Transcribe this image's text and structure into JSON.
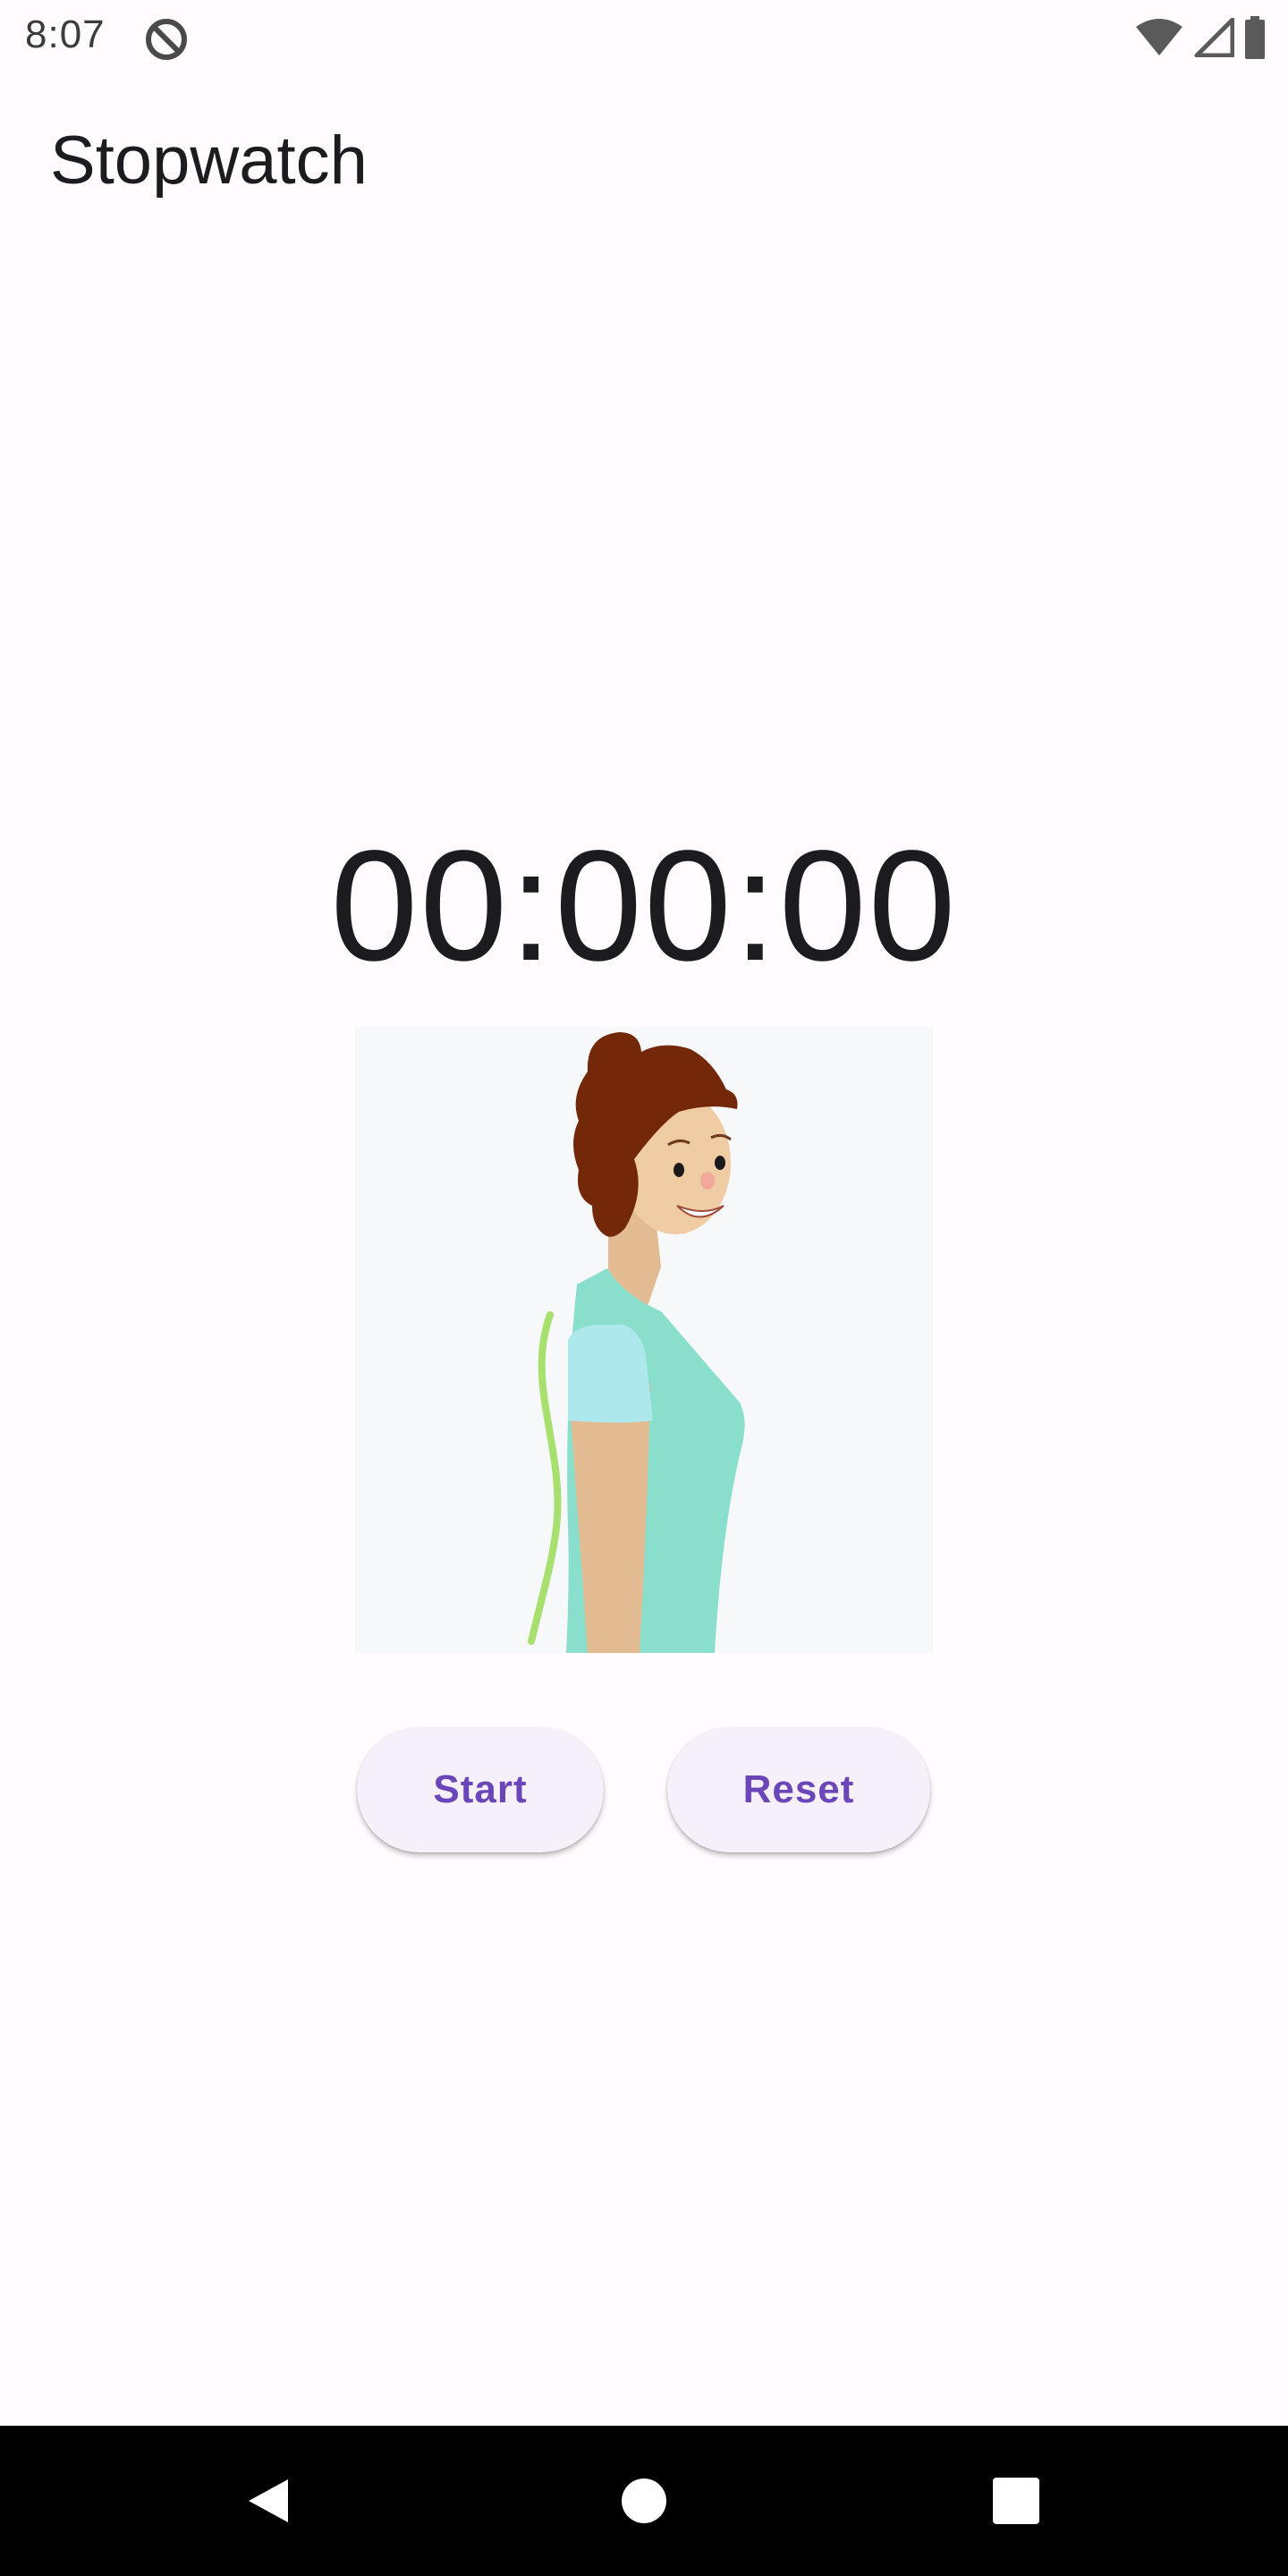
{
  "status_bar": {
    "time": "8:07",
    "icons": [
      "do-not-disturb-icon",
      "wifi-icon",
      "signal-icon",
      "battery-icon"
    ]
  },
  "app_bar": {
    "title": "Stopwatch"
  },
  "stopwatch": {
    "display": "00:00:00"
  },
  "illustration": {
    "subject": "woman-posture-illustration"
  },
  "controls": {
    "start_label": "Start",
    "reset_label": "Reset"
  },
  "nav_bar": {
    "icons": [
      "back-icon",
      "home-icon",
      "recents-icon"
    ]
  },
  "colors": {
    "background": "#fffbfe",
    "button_background": "#f5f0fa",
    "button_text": "#6a46b8",
    "text_primary": "#1c1b1f"
  }
}
